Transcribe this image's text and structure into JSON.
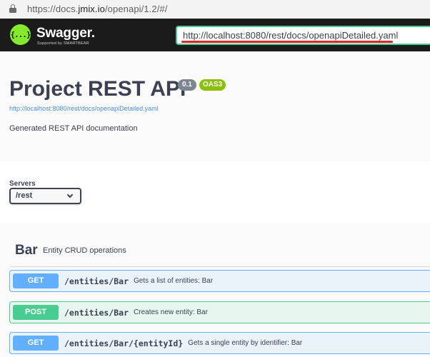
{
  "browser": {
    "url_prefix": "https://docs.",
    "url_domain": "jmix.io",
    "url_suffix": "/openapi/1.2/#/"
  },
  "topbar": {
    "logo_glyph": "{...}",
    "brand": "Swagger.",
    "brand_sub": "Supported by SMARTBEAR",
    "spec_url": "http://localhost:8080/rest/docs/openapiDetailed.yaml",
    "accent": "#85ea2d",
    "underline_color": "#e0232a"
  },
  "info": {
    "title": "Project REST API",
    "version": "0.1",
    "oas": "OAS3",
    "spec_link": "http://localhost:8080/rest/docs/openapiDetailed.yaml",
    "description": "Generated REST API documentation"
  },
  "servers": {
    "label": "Servers",
    "selected": "/rest"
  },
  "tag": {
    "name": "Bar",
    "description": "Entity CRUD operations"
  },
  "operations": [
    {
      "method": "GET",
      "path": "/entities/Bar",
      "summary": "Gets a list of entities: Bar",
      "color": "#61affe"
    },
    {
      "method": "POST",
      "path": "/entities/Bar",
      "summary": "Creates new entity: Bar",
      "color": "#49cc90"
    },
    {
      "method": "GET",
      "path": "/entities/Bar/{entityId}",
      "summary": "Gets a single entity by identifier: Bar",
      "color": "#61affe"
    }
  ]
}
